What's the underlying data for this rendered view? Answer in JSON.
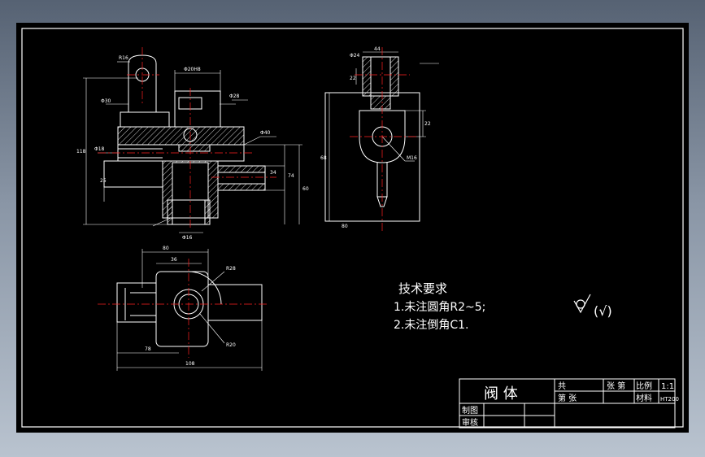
{
  "colors": {
    "background_gradient_top": "#566273",
    "background_gradient_bottom": "#b9c3cf",
    "canvas": "#000000",
    "line": "#ffffff",
    "centerline": "#ff2020",
    "dimension": "#ffffff",
    "hatch": "#ffffff"
  },
  "technical_requirements": {
    "title": "技术要求",
    "items": [
      "1.未注圆角R2~5;",
      "2.未注倒角C1."
    ]
  },
  "surface_symbol": {
    "icon": "roughness-check-icon",
    "label": "(√)"
  },
  "title_block": {
    "part_name": "阀 体",
    "sheet_count_label": "共",
    "sheet_label": "张 第",
    "sheet_num_label": "第 张",
    "scale_label": "比例",
    "scale_value": "1:1",
    "material_label": "材料",
    "material_value": "HT200",
    "drawn_label": "制图",
    "checked_label": "审核"
  },
  "dimensions": {
    "front": [
      "R16",
      "Φ20H8",
      "Φ30",
      "Φ28",
      "Φ40",
      "Φ18",
      "Φ16",
      "118",
      "74",
      "34",
      "25",
      "60"
    ],
    "side": [
      "Φ24",
      "44",
      "22",
      "68",
      "80",
      "22",
      "M16"
    ],
    "top": [
      "80",
      "36",
      "R28",
      "R20",
      "78",
      "108"
    ]
  }
}
